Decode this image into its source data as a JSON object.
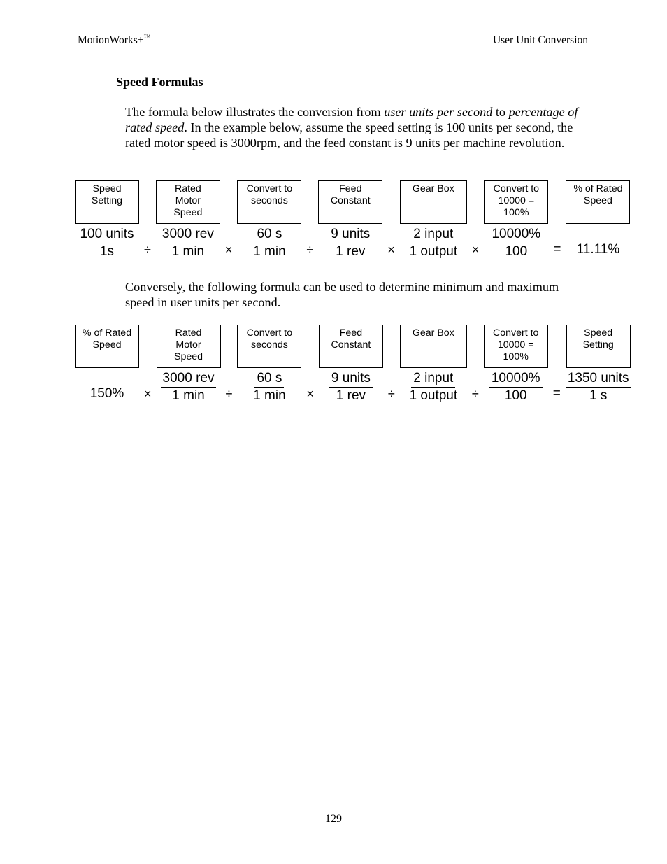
{
  "header": {
    "left_text": "MotionWorks+",
    "left_suffix": "™",
    "right_text": "User Unit Conversion"
  },
  "section": {
    "title": "Speed Formulas"
  },
  "paragraphs": {
    "intro_part1": "The formula below illustrates the conversion from ",
    "intro_em1": "user units per second",
    "intro_part2": " to ",
    "intro_em2": "percentage of rated speed",
    "intro_part3": ".  In the example below, assume the speed setting is 100 units per second, the rated motor speed is 3000rpm, and the feed constant is 9 units per machine revolution.",
    "converse": "Conversely, the following formula can be used to determine minimum and maximum speed in user units per second."
  },
  "formula1": {
    "terms": [
      {
        "caption": [
          "Speed",
          "Setting"
        ],
        "numerator": "100 units",
        "denominator": "1s"
      },
      {
        "caption": [
          "Rated",
          "Motor",
          "Speed"
        ],
        "numerator": "3000 rev",
        "denominator": "1 min"
      },
      {
        "caption": [
          "Convert to",
          "seconds"
        ],
        "numerator": "60 s",
        "denominator": "1 min"
      },
      {
        "caption": [
          "Feed",
          "Constant"
        ],
        "numerator": "9 units",
        "denominator": "1 rev"
      },
      {
        "caption": [
          "Gear Box"
        ],
        "numerator": "2 input",
        "denominator": "1 output"
      },
      {
        "caption": [
          "Convert to",
          "10000 =",
          "100%"
        ],
        "numerator": "10000%",
        "denominator": "100"
      },
      {
        "caption": [
          "% of Rated",
          "Speed"
        ],
        "scalar": "11.11%"
      }
    ],
    "operators": [
      "÷",
      "×",
      "÷",
      "×",
      "×",
      "="
    ]
  },
  "formula2": {
    "terms": [
      {
        "caption": [
          "% of Rated",
          "Speed"
        ],
        "scalar": "150%"
      },
      {
        "caption": [
          "Rated",
          "Motor",
          "Speed"
        ],
        "numerator": "3000 rev",
        "denominator": "1 min"
      },
      {
        "caption": [
          "Convert to",
          "seconds"
        ],
        "numerator": "60 s",
        "denominator": "1 min"
      },
      {
        "caption": [
          "Feed",
          "Constant"
        ],
        "numerator": "9 units",
        "denominator": "1 rev"
      },
      {
        "caption": [
          "Gear Box"
        ],
        "numerator": "2 input",
        "denominator": "1 output"
      },
      {
        "caption": [
          "Convert to",
          "10000 =",
          "100%"
        ],
        "numerator": "10000%",
        "denominator": "100"
      },
      {
        "caption": [
          "Speed",
          "Setting"
        ],
        "numerator": "1350 units",
        "denominator": "1 s"
      }
    ],
    "operators": [
      "×",
      "÷",
      "×",
      "÷",
      "÷",
      "="
    ]
  },
  "folio": {
    "page_number": "129"
  }
}
